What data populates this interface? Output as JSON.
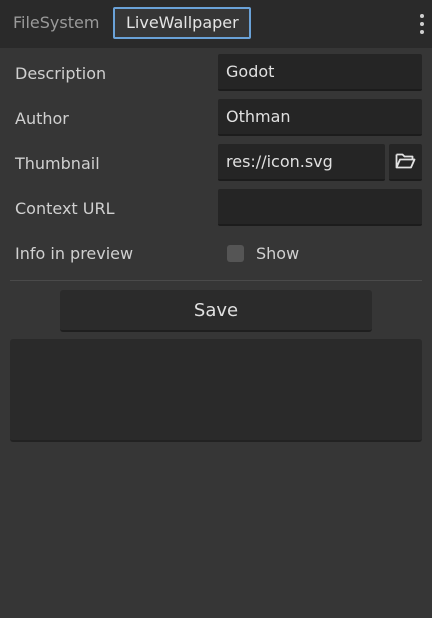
{
  "tabs": {
    "inactive_label": "FileSystem",
    "active_label": "LiveWallpaper"
  },
  "menu": {
    "icon": "vertical-ellipsis-icon"
  },
  "form": {
    "description": {
      "label": "Description",
      "value": "Godot"
    },
    "author": {
      "label": "Author",
      "value": "Othman"
    },
    "thumbnail": {
      "label": "Thumbnail",
      "value": "res://icon.svg",
      "browse_icon": "folder-open-icon"
    },
    "context_url": {
      "label": "Context URL",
      "value": ""
    },
    "info_in_preview": {
      "label": "Info in preview",
      "checkbox_label": "Show",
      "checked": false
    }
  },
  "save_label": "Save",
  "colors": {
    "background": "#363636",
    "tab_bar": "#2a2a2a",
    "field": "#252525",
    "active_tab_border": "#6aa2d8"
  }
}
